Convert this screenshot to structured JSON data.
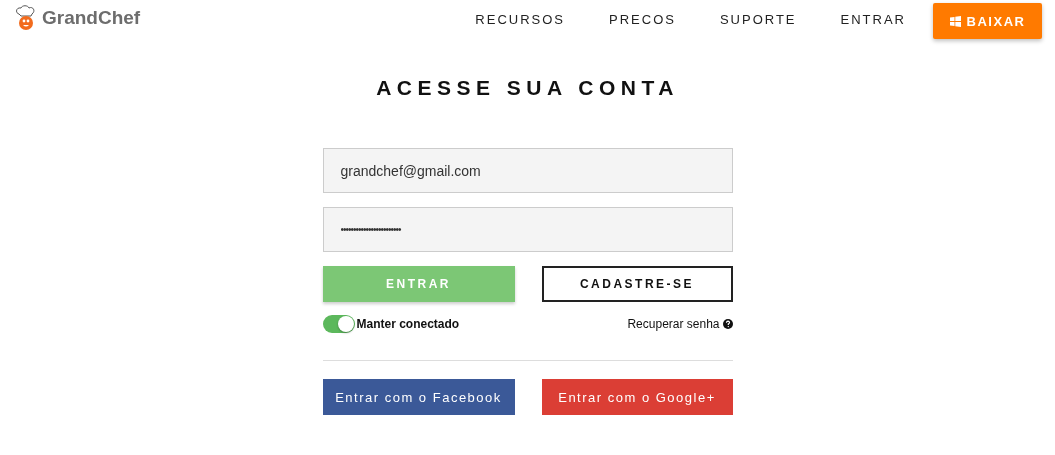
{
  "logo": {
    "text": "GrandChef"
  },
  "nav": [
    {
      "label": "RECURSOS"
    },
    {
      "label": "PRECOS"
    },
    {
      "label": "SUPORTE"
    },
    {
      "label": "ENTRAR"
    }
  ],
  "download_button": {
    "label": "BAIXAR"
  },
  "title": "ACESSE SUA CONTA",
  "email_field": {
    "value": "grandchef@gmail.com"
  },
  "password_field": {
    "value": "••••••••••••••••••••••••"
  },
  "login_button": {
    "label": "ENTRAR"
  },
  "signup_button": {
    "label": "CADASTRE-SE"
  },
  "keep_connected": {
    "label": "Manter conectado",
    "on": true
  },
  "recover_link": {
    "label": "Recuperar senha"
  },
  "social_buttons": [
    {
      "kind": "facebook",
      "label": "Entrar com o Facebook"
    },
    {
      "kind": "google",
      "label": "Entrar com o Google+"
    }
  ]
}
